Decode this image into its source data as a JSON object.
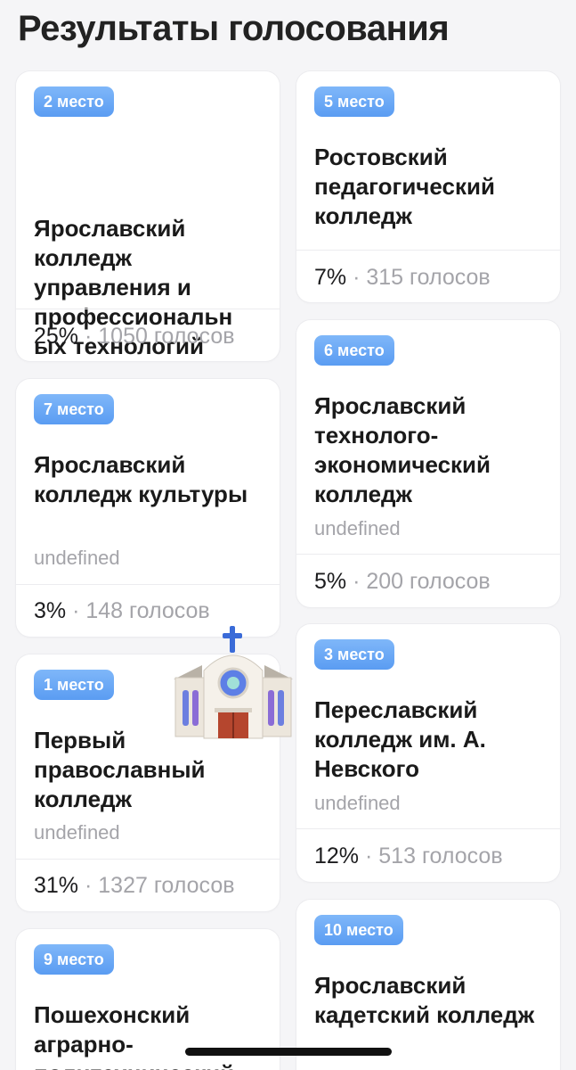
{
  "header": {
    "title": "Результаты голосования"
  },
  "cards": [
    {
      "place": "2 место",
      "name": "Ярославский колледж управления и профессиональн ых технологий",
      "sub": "",
      "percent": "25%",
      "votes": "1050 голосов"
    },
    {
      "place": "5 место",
      "name": "Ростовский педагогический колледж",
      "sub": "",
      "percent": "7%",
      "votes": "315 голосов"
    },
    {
      "place": "7 место",
      "name": "Ярославский колледж культуры",
      "sub": "undefined",
      "percent": "3%",
      "votes": "148 голосов"
    },
    {
      "place": "6 место",
      "name": "Ярославский технолого-экономический колледж",
      "sub": "undefined",
      "percent": "5%",
      "votes": "200 голосов"
    },
    {
      "place": "1 место",
      "name": "Первый православный колледж",
      "sub": "undefined",
      "percent": "31%",
      "votes": "1327 голосов"
    },
    {
      "place": "3 место",
      "name": "Переславский колледж им. А. Невского",
      "sub": "undefined",
      "percent": "12%",
      "votes": "513 голосов"
    },
    {
      "place": "9 место",
      "name": "Пошехонский аграрно-политехнический",
      "sub": "",
      "percent": "",
      "votes": ""
    },
    {
      "place": "10 место",
      "name": "Ярославский кадетский колледж",
      "sub": "",
      "percent": "",
      "votes": ""
    }
  ],
  "separator": "·",
  "emoji": {
    "name": "church-emoji",
    "colors": {
      "cross": "#3a6bd8",
      "wall": "#f2ede4",
      "roof": "#c9c3b9",
      "window": "#6c7fe0",
      "door": "#b5462e"
    }
  },
  "colors": {
    "badge": "#6aa8f6",
    "muted": "#a4a4a9",
    "text": "#1c1c1e",
    "background": "#f5f5f7"
  }
}
